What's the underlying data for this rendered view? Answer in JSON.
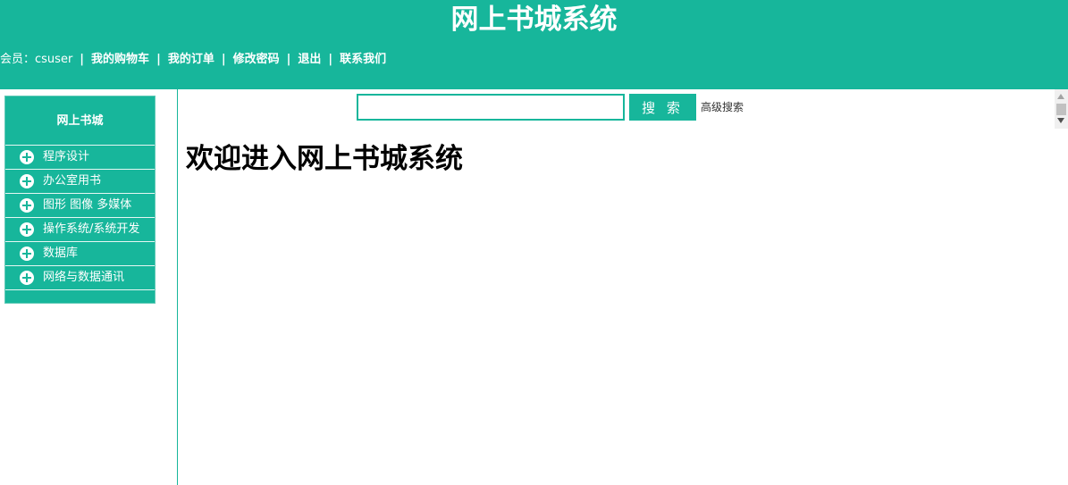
{
  "header": {
    "title": "网上书城系统",
    "nav": {
      "member_label": "会员：",
      "username": "csuser",
      "separator": "|",
      "links": [
        "我的购物车",
        "我的订单",
        "修改密码",
        "退出",
        "联系我们"
      ]
    }
  },
  "sidebar": {
    "panel_title": "网上书城",
    "categories": [
      "程序设计",
      "办公室用书",
      "图形 图像 多媒体",
      "操作系统/系统开发",
      "数据库",
      "网络与数据通讯"
    ]
  },
  "search": {
    "value": "",
    "button_label": "搜 索",
    "advanced_label": "高级搜索"
  },
  "main": {
    "welcome": "欢迎进入网上书城系统"
  },
  "colors": {
    "accent": "#17b69b",
    "text": "#000000"
  }
}
